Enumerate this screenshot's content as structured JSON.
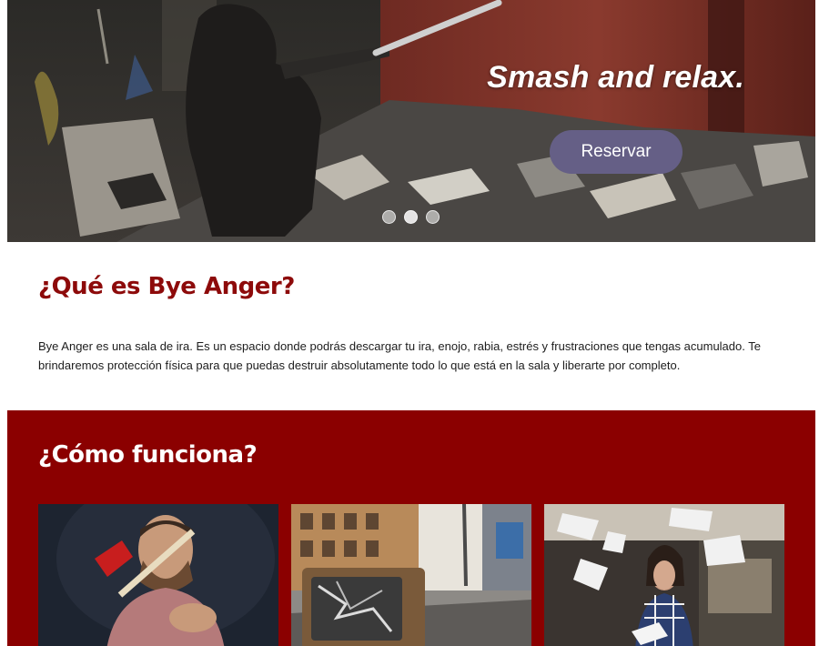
{
  "hero": {
    "title": "Smash and relax.",
    "cta_label": "Reservar",
    "carousel_dots": 3,
    "active_dot": 1
  },
  "about": {
    "heading": "¿Qué es Bye Anger?",
    "paragraph": "Bye Anger es una sala de ira. Es un espacio donde podrás descargar tu ira, enojo, rabia, estrés y frustraciones  que tengas acumulado. Te brindaremos protección física para que puedas destruir absolutamente todo lo que está en la sala y liberarte por completo."
  },
  "how": {
    "heading": "¿Cómo funciona?",
    "cards": [
      {
        "image": "man-with-axe"
      },
      {
        "image": "broken-tv-street"
      },
      {
        "image": "woman-meditating-papers"
      }
    ]
  },
  "colors": {
    "brand_red": "#8b0000",
    "heading_red": "#8d0a0a",
    "button": "#655f86"
  }
}
